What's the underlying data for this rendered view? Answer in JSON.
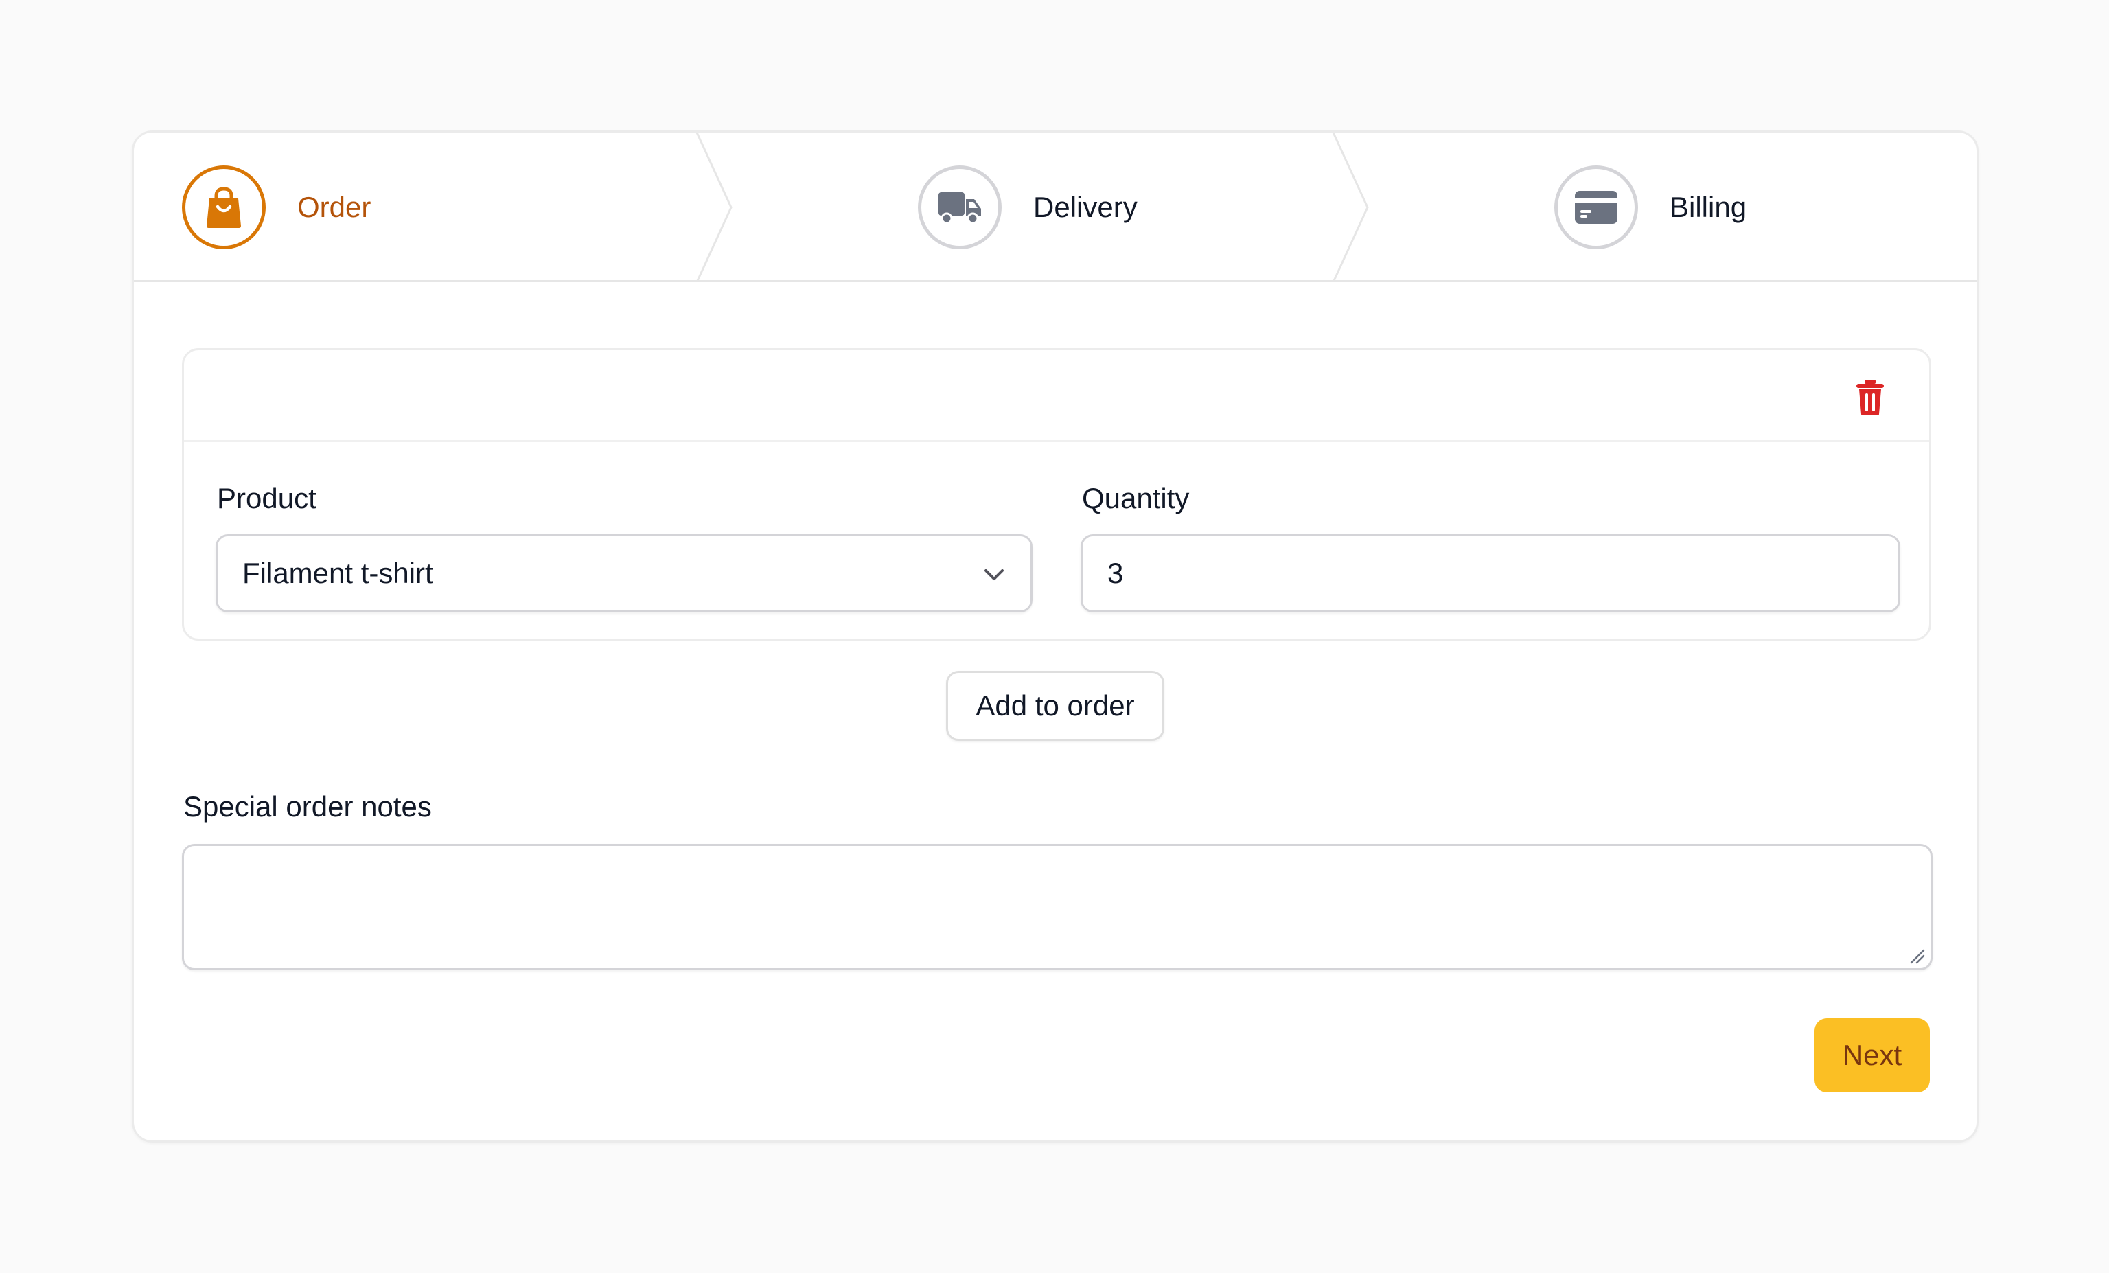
{
  "wizard": {
    "steps": [
      {
        "label": "Order",
        "icon": "shopping-bag-icon",
        "active": true
      },
      {
        "label": "Delivery",
        "icon": "truck-icon",
        "active": false
      },
      {
        "label": "Billing",
        "icon": "credit-card-icon",
        "active": false
      }
    ]
  },
  "order_item": {
    "product": {
      "label": "Product",
      "value": "Filament t-shirt"
    },
    "quantity": {
      "label": "Quantity",
      "value": "3"
    },
    "delete_icon": "trash-icon"
  },
  "add_item_label": "Add to order",
  "notes": {
    "label": "Special order notes",
    "value": ""
  },
  "next_label": "Next",
  "colors": {
    "accent": "#d97706",
    "accent_text": "#b45309",
    "primary_button": "#fbbf24",
    "danger": "#dc2626",
    "inactive_icon": "#6b7280"
  }
}
